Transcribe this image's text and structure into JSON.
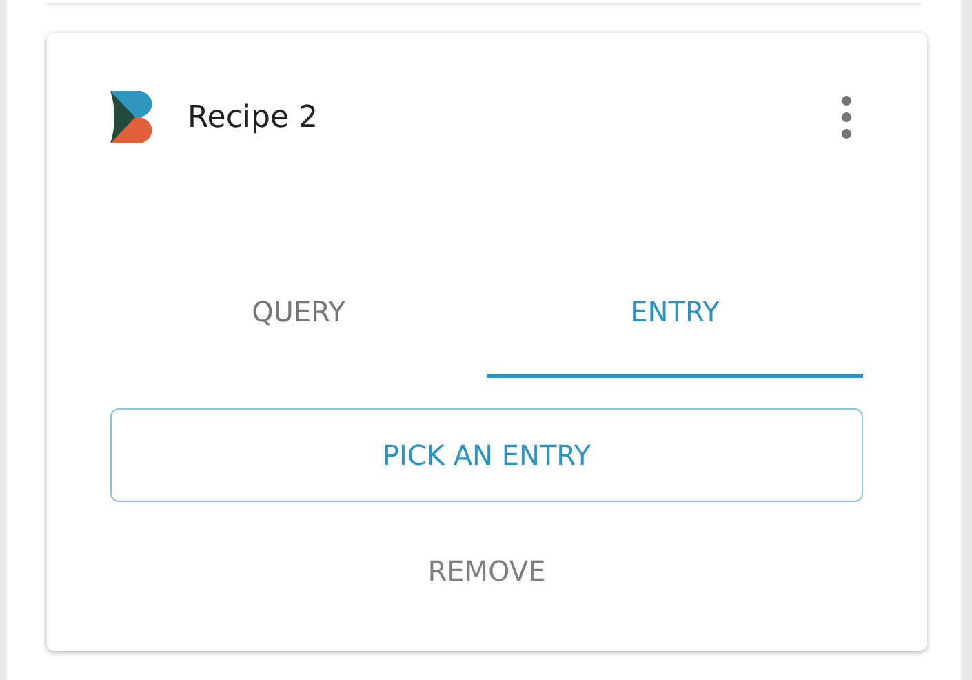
{
  "card": {
    "title": "Recipe 2"
  },
  "tabs": [
    {
      "label": "QUERY",
      "selected": false
    },
    {
      "label": "ENTRY",
      "selected": true
    }
  ],
  "primary_button": "PICK AN ENTRY",
  "secondary_button": "REMOVE"
}
